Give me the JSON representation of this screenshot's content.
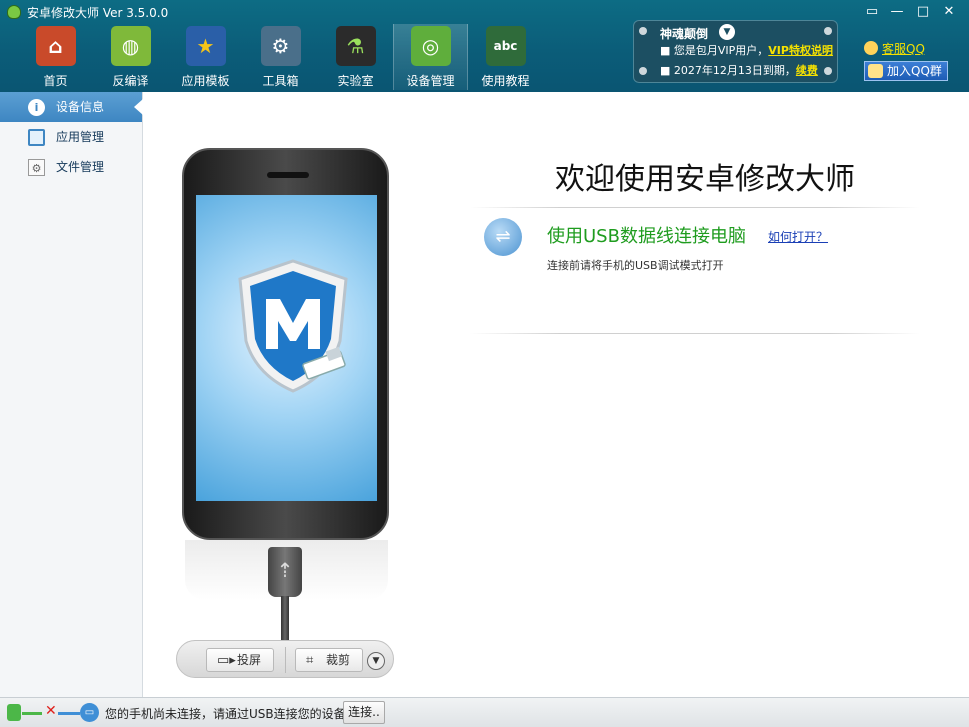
{
  "app": {
    "title": "安卓修改大师 Ver 3.5.0.0",
    "window_controls": [
      "▭",
      "—",
      "□",
      "✕"
    ]
  },
  "nav": {
    "items": [
      {
        "label": "首页",
        "icon": "house-icon",
        "glyph": "⌂",
        "color": "#c94a2a"
      },
      {
        "label": "反编译",
        "icon": "android-icon",
        "glyph": "◍",
        "color": "#7fb93a"
      },
      {
        "label": "应用模板",
        "icon": "star-icon",
        "glyph": "★",
        "color": "#2a5fa8"
      },
      {
        "label": "工具箱",
        "icon": "gear-icon",
        "glyph": "⚙",
        "color": "#4a6f8a"
      },
      {
        "label": "实验室",
        "icon": "flask-icon",
        "glyph": "⚗",
        "color": "#2b2b2b"
      },
      {
        "label": "设备管理",
        "icon": "radar-icon",
        "glyph": "◎",
        "color": "#5fae3c"
      },
      {
        "label": "使用教程",
        "icon": "blackboard-icon",
        "glyph": "abc",
        "color": "#2f6b3a"
      }
    ],
    "active_index": 5
  },
  "vip": {
    "name": "神魂颠倒",
    "line1_prefix": "■ 您是包月VIP用户，",
    "line1_link": "VIP特权说明",
    "line2_prefix": "■ 2027年12月13日到期，",
    "line2_link": "续费"
  },
  "service": {
    "label": "客服QQ",
    "join_label": "加入QQ群"
  },
  "sidebar": {
    "items": [
      {
        "label": "设备信息",
        "icon": "info-icon",
        "glyph": "i",
        "active": true
      },
      {
        "label": "应用管理",
        "icon": "app-window-icon",
        "glyph": "",
        "active": false
      },
      {
        "label": "文件管理",
        "icon": "file-icon",
        "glyph": "⚙",
        "active": false
      }
    ]
  },
  "main": {
    "welcome": "欢迎使用安卓修改大师",
    "usb_heading": "使用USB数据线连接电脑",
    "howto_link": "如何打开？",
    "usb_hint": "连接前请将手机的USB调试模式打开",
    "screen_cast_label": "投屏",
    "crop_label": "裁剪"
  },
  "status": {
    "message": "您的手机尚未连接，请通过USB连接您的设备..",
    "connect_label": "连接.."
  },
  "colors": {
    "topbar": "#0b5d79",
    "accent_green": "#1f9c1f",
    "link_yellow": "#f5e100",
    "sidebar_active": "#3e86c2"
  }
}
